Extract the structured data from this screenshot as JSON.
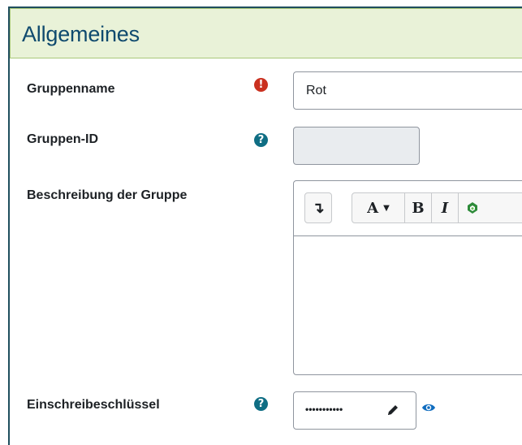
{
  "section": {
    "title": "Allgemeines"
  },
  "fields": {
    "group_name": {
      "label": "Gruppenname",
      "value": "Rot",
      "required_icon": "exclamation-circle-icon"
    },
    "group_id": {
      "label": "Gruppen-ID",
      "value": "",
      "help_icon": "question-circle-icon"
    },
    "description": {
      "label": "Beschreibung der Gruppe",
      "toolbar": {
        "toggle_label": "↴",
        "font_label": "A",
        "bold_label": "B",
        "italic_label": "I"
      }
    },
    "enrolment_key": {
      "label": "Einschreibeschlüssel",
      "value": "•••••••••••",
      "help_icon": "question-circle-icon",
      "reveal_icon": "eye-icon",
      "edit_icon": "pencil-icon"
    }
  },
  "colors": {
    "header_bg": "#e9f2d8",
    "title": "#0f4a6e",
    "required": "#ca3120",
    "help": "#0f6e84"
  }
}
